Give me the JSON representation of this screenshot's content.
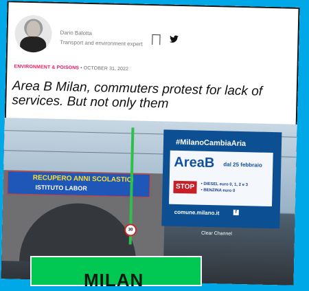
{
  "author": {
    "name": "Dario Balotta",
    "role": "Transport and environment expert"
  },
  "meta": {
    "category": "ENVIRONMENT & POISONS",
    "date": "OCTOBER 31, 2022"
  },
  "article": {
    "title": "Area B Milan, commuters protest for lack of services. But not only them"
  },
  "photo": {
    "banner": {
      "line1": "RECUPERO ANNI SCOLASTICI",
      "line2": "ISTITUTO LABOR"
    },
    "billboard": {
      "hashtag": "#MilanoCambiaAria",
      "area": "AreaB",
      "start": "dal 25 febbraio",
      "stop": "STOP",
      "fuel_lines": [
        "• DIESEL euro 0, 1, 2 e 3",
        "• BENZINA euro 0"
      ],
      "url": "comune.milano.it",
      "brand": "Clear Channel",
      "fb": "f"
    },
    "sign": "30"
  },
  "overlay": {
    "text": "MILAN"
  },
  "icons": {
    "bookmark": "bookmark-icon",
    "twitter": "twitter-icon"
  },
  "colors": {
    "background": "#00a8e8",
    "category": "#e7195b",
    "overlay": "#00c853"
  }
}
